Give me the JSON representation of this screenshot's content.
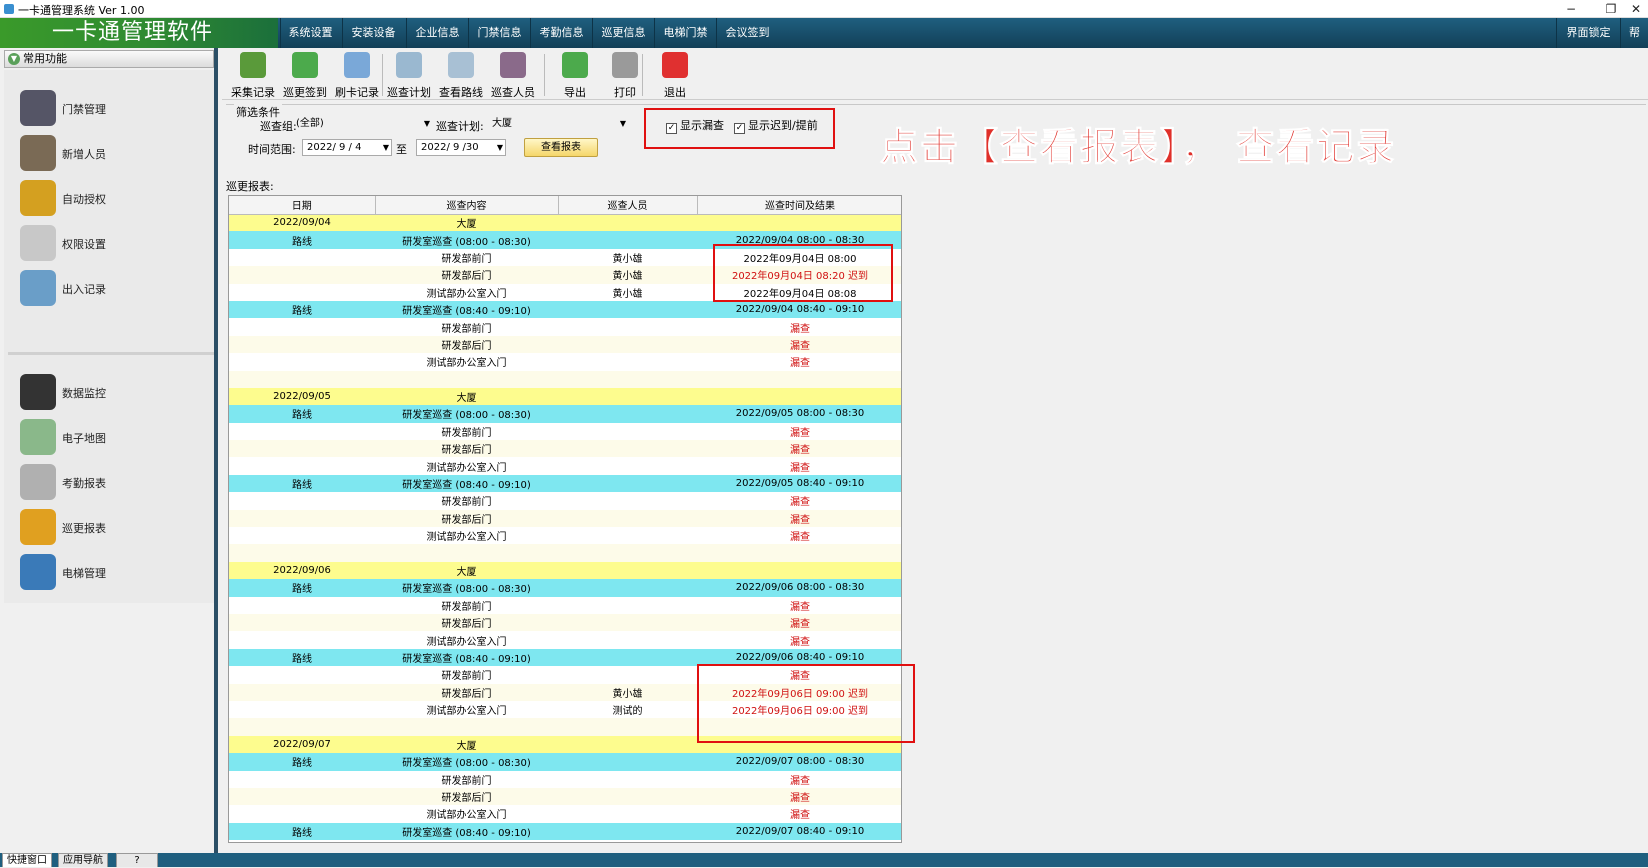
{
  "window": {
    "title": "一卡通管理系统  Ver 1.00",
    "min": "−",
    "restore": "❐",
    "close": "✕"
  },
  "app": {
    "logo": "一卡通管理软件"
  },
  "menu": [
    "系统设置",
    "安装设备",
    "企业信息",
    "门禁信息",
    "考勤信息",
    "巡更信息",
    "电梯门禁",
    "会议签到"
  ],
  "menu_right": [
    "界面锁定",
    "帮"
  ],
  "left_panel": {
    "header": "常用功能",
    "group1": [
      {
        "label": "门禁管理",
        "icon": "door-control-icon",
        "color": "#556"
      },
      {
        "label": "新增人员",
        "icon": "person-icon",
        "color": "#7a6a55"
      },
      {
        "label": "自动授权",
        "icon": "card-icon",
        "color": "#d4a020"
      },
      {
        "label": "权限设置",
        "icon": "permission-icon",
        "color": "#c8c8c8"
      },
      {
        "label": "出入记录",
        "icon": "magnifier-icon",
        "color": "#6a9ec8"
      }
    ],
    "group2": [
      {
        "label": "数据监控",
        "icon": "camera-icon",
        "color": "#333"
      },
      {
        "label": "电子地图",
        "icon": "map-icon",
        "color": "#8ab88a"
      },
      {
        "label": "考勤报表",
        "icon": "clock-icon",
        "color": "#b0b0b0"
      },
      {
        "label": "巡更报表",
        "icon": "patrol-icon",
        "color": "#e0a020"
      },
      {
        "label": "电梯管理",
        "icon": "elevator-icon",
        "color": "#3a7ab8"
      }
    ]
  },
  "toolbar": [
    {
      "label": "采集记录",
      "icon": "collect-icon",
      "color": "#5a9a3a"
    },
    {
      "label": "巡更签到",
      "icon": "add-icon",
      "color": "#4caa4c"
    },
    {
      "label": "刷卡记录",
      "icon": "search-record-icon",
      "color": "#7aa8d8"
    },
    {
      "label": "巡查计划",
      "icon": "plan-icon",
      "color": "#9ab8d0"
    },
    {
      "label": "查看路线",
      "icon": "route-icon",
      "color": "#a8c0d4"
    },
    {
      "label": "巡查人员",
      "icon": "people-icon",
      "color": "#8a6a8a"
    },
    {
      "label": "导出",
      "icon": "export-icon",
      "color": "#4caa4c"
    },
    {
      "label": "打印",
      "icon": "printer-icon",
      "color": "#9a9a9a"
    },
    {
      "label": "退出",
      "icon": "power-icon",
      "color": "#e03030"
    }
  ],
  "filter": {
    "legend": "筛选条件",
    "group_label": "巡查组:",
    "group_value": "(全部)",
    "plan_label": "巡查计划:",
    "plan_value": "大厦",
    "show_missed": "显示漏查",
    "show_late": "显示迟到/提前",
    "range_label": "时间范围:",
    "date_from": "2022/ 9 / 4",
    "to": "至",
    "date_to": "2022/ 9 /30",
    "view_button": "查看报表"
  },
  "annotation": "点击【查看报表】， 查看记录",
  "report": {
    "title": "巡更报表:",
    "columns": [
      "日期",
      "巡查内容",
      "巡查人员",
      "巡查时间及结果"
    ],
    "rows": [
      {
        "t": "date",
        "c": [
          "2022/09/04",
          "大厦",
          "",
          ""
        ]
      },
      {
        "t": "plan",
        "c": [
          "路线",
          "研发室巡查 (08:00 - 08:30)",
          "",
          "2022/09/04 08:00 - 08:30"
        ]
      },
      {
        "t": "white",
        "c": [
          "",
          "研发部前门",
          "黄小雄",
          "2022年09月04日 08:00"
        ]
      },
      {
        "t": "stripe",
        "c": [
          "",
          "研发部后门",
          "黄小雄",
          "2022年09月04日 08:20 迟到"
        ],
        "s": "late"
      },
      {
        "t": "white",
        "c": [
          "",
          "测试部办公室入门",
          "黄小雄",
          "2022年09月04日 08:08"
        ]
      },
      {
        "t": "plan",
        "c": [
          "路线",
          "研发室巡查 (08:40 - 09:10)",
          "",
          "2022/09/04 08:40 - 09:10"
        ]
      },
      {
        "t": "white",
        "c": [
          "",
          "研发部前门",
          "",
          "漏查"
        ],
        "s": "miss"
      },
      {
        "t": "stripe",
        "c": [
          "",
          "研发部后门",
          "",
          "漏查"
        ],
        "s": "miss"
      },
      {
        "t": "white",
        "c": [
          "",
          "测试部办公室入门",
          "",
          "漏查"
        ],
        "s": "miss"
      },
      {
        "t": "stripe",
        "c": [
          "",
          "",
          "",
          ""
        ]
      },
      {
        "t": "date",
        "c": [
          "2022/09/05",
          "大厦",
          "",
          ""
        ]
      },
      {
        "t": "plan",
        "c": [
          "路线",
          "研发室巡查 (08:00 - 08:30)",
          "",
          "2022/09/05 08:00 - 08:30"
        ]
      },
      {
        "t": "white",
        "c": [
          "",
          "研发部前门",
          "",
          "漏查"
        ],
        "s": "miss"
      },
      {
        "t": "stripe",
        "c": [
          "",
          "研发部后门",
          "",
          "漏查"
        ],
        "s": "miss"
      },
      {
        "t": "white",
        "c": [
          "",
          "测试部办公室入门",
          "",
          "漏查"
        ],
        "s": "miss"
      },
      {
        "t": "plan",
        "c": [
          "路线",
          "研发室巡查 (08:40 - 09:10)",
          "",
          "2022/09/05 08:40 - 09:10"
        ]
      },
      {
        "t": "white",
        "c": [
          "",
          "研发部前门",
          "",
          "漏查"
        ],
        "s": "miss"
      },
      {
        "t": "stripe",
        "c": [
          "",
          "研发部后门",
          "",
          "漏查"
        ],
        "s": "miss"
      },
      {
        "t": "white",
        "c": [
          "",
          "测试部办公室入门",
          "",
          "漏查"
        ],
        "s": "miss"
      },
      {
        "t": "stripe",
        "c": [
          "",
          "",
          "",
          ""
        ]
      },
      {
        "t": "date",
        "c": [
          "2022/09/06",
          "大厦",
          "",
          ""
        ]
      },
      {
        "t": "plan",
        "c": [
          "路线",
          "研发室巡查 (08:00 - 08:30)",
          "",
          "2022/09/06 08:00 - 08:30"
        ]
      },
      {
        "t": "white",
        "c": [
          "",
          "研发部前门",
          "",
          "漏查"
        ],
        "s": "miss"
      },
      {
        "t": "stripe",
        "c": [
          "",
          "研发部后门",
          "",
          "漏查"
        ],
        "s": "miss"
      },
      {
        "t": "white",
        "c": [
          "",
          "测试部办公室入门",
          "",
          "漏查"
        ],
        "s": "miss"
      },
      {
        "t": "plan",
        "c": [
          "路线",
          "研发室巡查 (08:40 - 09:10)",
          "",
          "2022/09/06 08:40 - 09:10"
        ]
      },
      {
        "t": "white",
        "c": [
          "",
          "研发部前门",
          "",
          "漏查"
        ],
        "s": "miss"
      },
      {
        "t": "stripe",
        "c": [
          "",
          "研发部后门",
          "黄小雄",
          "2022年09月06日 09:00 迟到"
        ],
        "s": "late"
      },
      {
        "t": "white",
        "c": [
          "",
          "测试部办公室入门",
          "测试的",
          "2022年09月06日 09:00 迟到"
        ],
        "s": "late"
      },
      {
        "t": "stripe",
        "c": [
          "",
          "",
          "",
          ""
        ]
      },
      {
        "t": "date",
        "c": [
          "2022/09/07",
          "大厦",
          "",
          ""
        ]
      },
      {
        "t": "plan",
        "c": [
          "路线",
          "研发室巡查 (08:00 - 08:30)",
          "",
          "2022/09/07 08:00 - 08:30"
        ]
      },
      {
        "t": "white",
        "c": [
          "",
          "研发部前门",
          "",
          "漏查"
        ],
        "s": "miss"
      },
      {
        "t": "stripe",
        "c": [
          "",
          "研发部后门",
          "",
          "漏查"
        ],
        "s": "miss"
      },
      {
        "t": "white",
        "c": [
          "",
          "测试部办公室入门",
          "",
          "漏查"
        ],
        "s": "miss"
      },
      {
        "t": "plan",
        "c": [
          "路线",
          "研发室巡查 (08:40 - 09:10)",
          "",
          "2022/09/07 08:40 - 09:10"
        ]
      }
    ]
  },
  "bottom_tabs": [
    "快捷窗口",
    "应用导航",
    "?"
  ]
}
